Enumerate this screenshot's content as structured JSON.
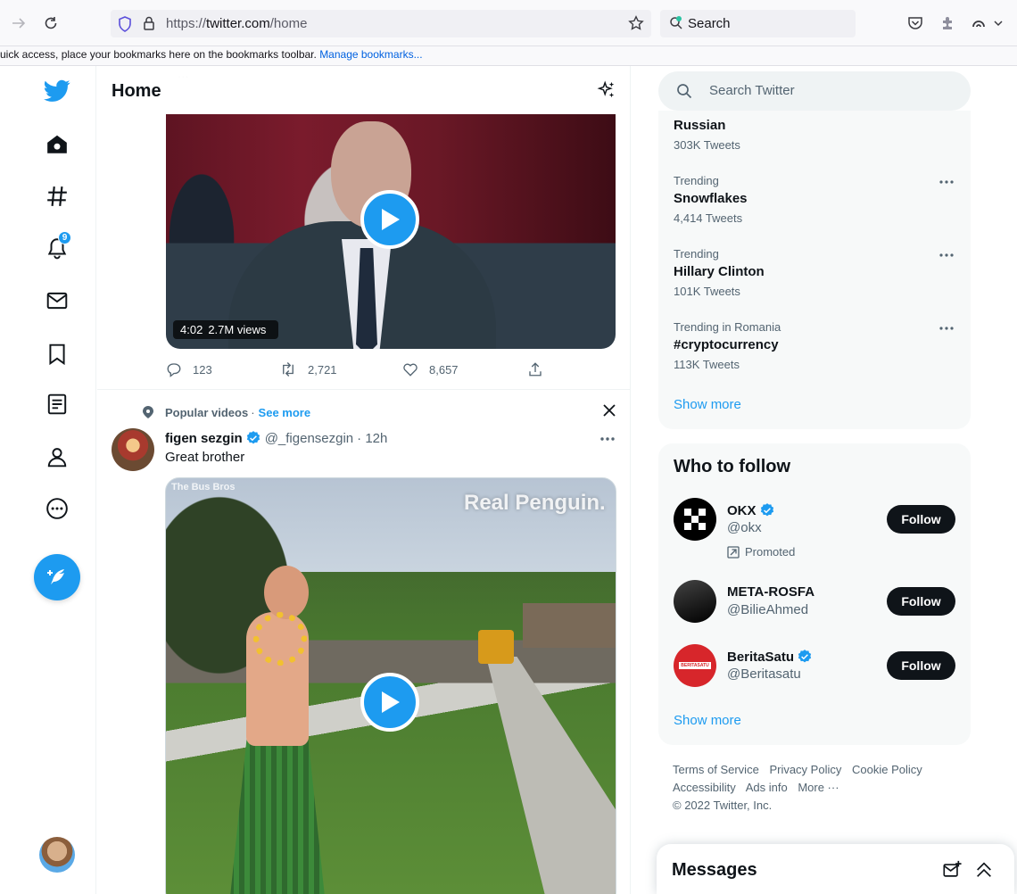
{
  "browser": {
    "url_scheme": "https://",
    "url_host": "twitter.com",
    "url_path": "/home",
    "search_placeholder": "Search",
    "bookmarks_message": "uick access, place your bookmarks here on the bookmarks toolbar.",
    "bookmarks_link": "Manage bookmarks..."
  },
  "nav": {
    "notification_count": "9"
  },
  "main": {
    "title": "Home",
    "ghost_text": "...",
    "video1": {
      "duration": "4:02",
      "views": "2.7M views"
    },
    "actions": {
      "replies": "123",
      "retweets": "2,721",
      "likes": "8,657"
    },
    "popular": {
      "label": "Popular videos",
      "separator": " · ",
      "see_more": "See more"
    },
    "tweet": {
      "name": "figen sezgin",
      "handle": "@_figensezgin",
      "time": "· 12h",
      "text": "Great brother"
    },
    "video2": {
      "caption": "Real Penguin.",
      "source": "The Bus Bros"
    }
  },
  "sidebar": {
    "search_placeholder": "Search Twitter",
    "trends": [
      {
        "context": "",
        "name": "Russian",
        "count": "303K Tweets"
      },
      {
        "context": "Trending",
        "name": "Snowflakes",
        "count": "4,414 Tweets"
      },
      {
        "context": "Trending",
        "name": "Hillary Clinton",
        "count": "101K Tweets"
      },
      {
        "context": "Trending in Romania",
        "name": "#cryptocurrency",
        "count": "113K Tweets"
      }
    ],
    "trends_show_more": "Show more",
    "who_to_follow": {
      "title": "Who to follow",
      "accounts": [
        {
          "name": "OKX",
          "handle": "@okx",
          "verified": true,
          "follow_label": "Follow"
        },
        {
          "name": "META-ROSFA",
          "handle": "@BilieAhmed",
          "verified": false,
          "follow_label": "Follow"
        },
        {
          "name": "BeritaSatu",
          "handle": "@Beritasatu",
          "verified": true,
          "follow_label": "Follow"
        }
      ],
      "promoted_label": "Promoted",
      "beritasatu_logo_text": "BERITASATU",
      "show_more": "Show more"
    },
    "footer": {
      "terms": "Terms of Service",
      "privacy": "Privacy Policy",
      "cookie": "Cookie Policy",
      "accessibility": "Accessibility",
      "ads": "Ads info",
      "more": "More ···",
      "copyright": "© 2022 Twitter, Inc."
    },
    "messages_title": "Messages"
  },
  "colors": {
    "accent": "#1d9bf0",
    "text": "#0f1419",
    "muted": "#536471"
  }
}
